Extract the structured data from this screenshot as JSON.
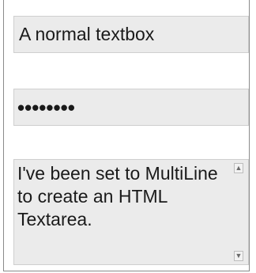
{
  "form": {
    "textbox_value": "A normal textbox",
    "password_value": "••••••••",
    "textarea_value": "I've been set to MultiLine to create an HTML Textarea."
  },
  "icons": {
    "scroll_up": "▲",
    "scroll_down": "▼"
  },
  "colors": {
    "field_background": "#ebebeb",
    "field_border": "#cfcfcf",
    "frame_border": "#8a8a8a"
  }
}
